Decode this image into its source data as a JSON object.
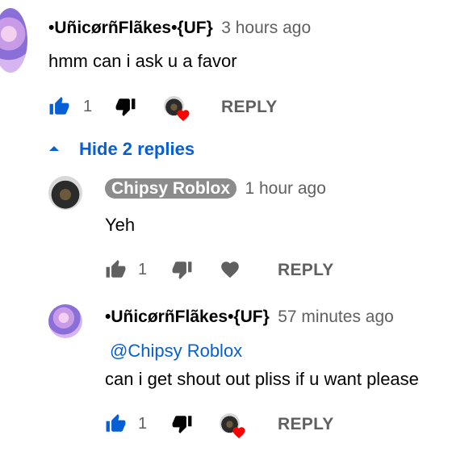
{
  "comment": {
    "author": "•UñicørñFlãkes•{UF}",
    "time": "3 hours ago",
    "text": "hmm can i ask u a favor",
    "likes": "1",
    "reply_label": "REPLY",
    "hide_replies_label": "Hide 2 replies"
  },
  "replies": [
    {
      "author": "Chipsy Roblox",
      "time": "1 hour ago",
      "text": "Yeh",
      "likes": "1",
      "reply_label": "REPLY"
    },
    {
      "author": "•UñicørñFlãkes•{UF}",
      "time": "57 minutes ago",
      "mention": "@Chipsy Roblox",
      "text": "can i get shout out pliss if u want please",
      "likes": "1",
      "reply_label": "REPLY"
    }
  ],
  "colors": {
    "link_blue": "#065fd4",
    "secondary_text": "#606060",
    "heart_red": "#ff0000"
  }
}
